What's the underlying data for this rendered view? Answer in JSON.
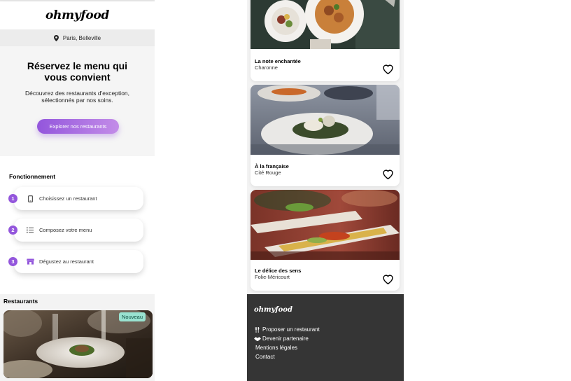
{
  "header": {
    "logo": "ohmyfood"
  },
  "location": {
    "text": "Paris, Belleville",
    "icon": "map-pin-icon"
  },
  "hero": {
    "title": "Réservez le menu qui vous convient",
    "subtitle": "Découvrez des restaurants d'exception, sélectionnés par nos soins.",
    "button_label": "Explorer nos restaurants"
  },
  "how_it_works": {
    "title": "Fonctionnement",
    "steps": [
      {
        "number": "1",
        "label": "Choisissez un restaurant",
        "icon": "smartphone-icon"
      },
      {
        "number": "2",
        "label": "Composez votre menu",
        "icon": "list-icon"
      },
      {
        "number": "3",
        "label": "Dégustez au restaurant",
        "icon": "store-icon"
      }
    ]
  },
  "restaurants": {
    "title": "Restaurants",
    "new_badge": "Nouveau"
  },
  "restaurant_cards": [
    {
      "name": "La note enchantée",
      "area": "Charonne"
    },
    {
      "name": "À la française",
      "area": "Cité Rouge"
    },
    {
      "name": "Le délice des sens",
      "area": "Folie-Méricourt"
    }
  ],
  "footer": {
    "logo": "ohmyfood",
    "links": [
      {
        "label": "Proposer un restaurant",
        "icon": "utensils-icon"
      },
      {
        "label": "Devenir partenaire",
        "icon": "handshake-icon"
      },
      {
        "label": "Mentions légales",
        "icon": ""
      },
      {
        "label": "Contact",
        "icon": ""
      }
    ]
  },
  "colors": {
    "accent": "#9356dc",
    "accent_light": "#c38ce8",
    "badge_bg": "#99e2d0",
    "footer_bg": "#353535",
    "section_bg": "#f5f5f5"
  }
}
